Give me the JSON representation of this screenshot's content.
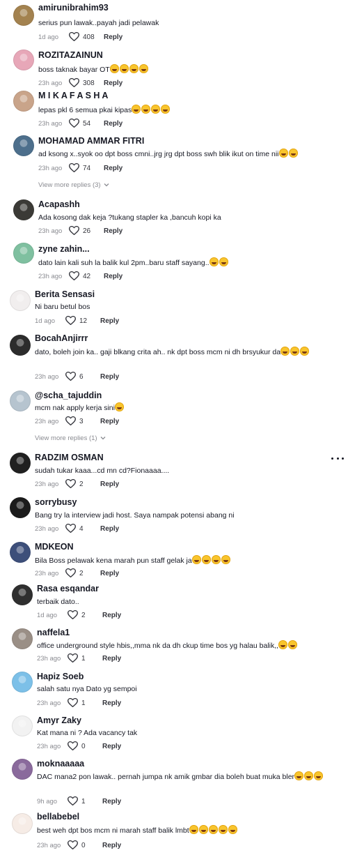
{
  "comments": [
    {
      "username": "amirunibrahim93",
      "text": "serius pun lawak..payah jadi pelawak",
      "emoji_count": 0,
      "ago": "1d ago",
      "likes": "408",
      "reply": "Reply",
      "avatar_color": "#a3824f"
    },
    {
      "username": "ROZITAZAINUN",
      "text": "boss taknak bayar OT",
      "emoji_count": 4,
      "ago": "23h ago",
      "likes": "308",
      "reply": "Reply",
      "avatar_color": "#e7a7b8"
    },
    {
      "username": "M I K A F A S H A",
      "text": "lepas pkl 6 semua pkai kipas",
      "emoji_count": 4,
      "ago": "23h ago",
      "likes": "54",
      "reply": "Reply",
      "avatar_color": "#c9a48a"
    },
    {
      "username": "MOHAMAD AMMAR FITRI",
      "text": "ad ksong x..syok oo dpt boss cmni..jrg jrg dpt boss swh blik ikut on time nii",
      "emoji_count": 2,
      "ago": "23h ago",
      "likes": "74",
      "reply": "Reply",
      "avatar_color": "#4d6f8c",
      "view_more": "View more replies (3)"
    },
    {
      "username": "Acapashh",
      "text": "Ada kosong dak keja ?tukang stapler ka ,bancuh kopi ka",
      "emoji_count": 0,
      "ago": "23h ago",
      "likes": "26",
      "reply": "Reply",
      "avatar_color": "#3b3a36"
    },
    {
      "username": "zyne zahin...",
      "text": "dato lain kali suh la balik kul 2pm..baru staff sayang..",
      "emoji_count": 2,
      "ago": "23h ago",
      "likes": "42",
      "reply": "Reply",
      "avatar_color": "#7fc0a0"
    },
    {
      "username": "Berita Sensasi",
      "text": "Ni baru betul bos",
      "emoji_count": 0,
      "ago": "1d ago",
      "likes": "12",
      "reply": "Reply",
      "avatar_color": "#f1eeee"
    },
    {
      "username": "BocahAnjirrr",
      "text": "dato, boleh join ka.. gaji blkang crita ah.. nk dpt boss mcm ni dh brsyukur da",
      "emoji_count": 3,
      "ago": "23h ago",
      "likes": "6",
      "reply": "Reply",
      "avatar_color": "#2c2c2c"
    },
    {
      "username": "@scha_tajuddin",
      "text": "mcm nak apply kerja sini",
      "emoji_count": 1,
      "ago": "23h ago",
      "likes": "3",
      "reply": "Reply",
      "avatar_color": "#b6c4cf",
      "view_more": "View more replies (1)"
    },
    {
      "username": "RADZIM OSMAN",
      "text": "sudah tukar kaaa...cd mn cd?Fionaaaa....",
      "emoji_count": 0,
      "ago": "23h ago",
      "likes": "2",
      "reply": "Reply",
      "avatar_color": "#202020"
    },
    {
      "username": "sorrybusy",
      "text": "Bang try la interview jadi host. Saya nampak potensi abang ni",
      "emoji_count": 0,
      "ago": "23h ago",
      "likes": "4",
      "reply": "Reply",
      "avatar_color": "#1b1b1b"
    },
    {
      "username": "MDKEON",
      "text": "Bila Boss pelawak kena marah pun staff gelak ja",
      "emoji_count": 4,
      "ago": "23h ago",
      "likes": "2",
      "reply": "Reply",
      "avatar_color": "#3d4f7a"
    },
    {
      "username": "Rasa esqandar",
      "text": "terbaik dato..",
      "emoji_count": 0,
      "ago": "1d ago",
      "likes": "2",
      "reply": "Reply",
      "avatar_color": "#2f2f2f"
    },
    {
      "username": "naffela1",
      "text": "office underground style hbis,,mma nk da dh ckup time bos yg halau balik,,",
      "emoji_count": 2,
      "ago": "23h ago",
      "likes": "1",
      "reply": "Reply",
      "avatar_color": "#9a8f86"
    },
    {
      "username": "Hapiz Soeb",
      "text": "salah satu nya Dato yg sempoi",
      "emoji_count": 0,
      "ago": "23h ago",
      "likes": "1",
      "reply": "Reply",
      "avatar_color": "#7cc0e8"
    },
    {
      "username": "Amyr Zaky",
      "text": "Kat mana ni ? Ada vacancy tak",
      "emoji_count": 0,
      "ago": "23h ago",
      "likes": "0",
      "reply": "Reply",
      "avatar_color": "#f2f2f2"
    },
    {
      "username": "moknaaaaa",
      "text": "DAC mana2 pon lawak.. pernah jumpa nk amik gmbar dia boleh buat muka bler",
      "emoji_count": 3,
      "ago": "9h ago",
      "likes": "1",
      "reply": "Reply",
      "avatar_color": "#8a6a9c"
    },
    {
      "username": "bellabebel",
      "text": "best weh dpt bos mcm ni marah staff balik lmbt",
      "emoji_count": 5,
      "ago": "23h ago",
      "likes": "0",
      "reply": "Reply",
      "avatar_color": "#f6ece6"
    }
  ]
}
